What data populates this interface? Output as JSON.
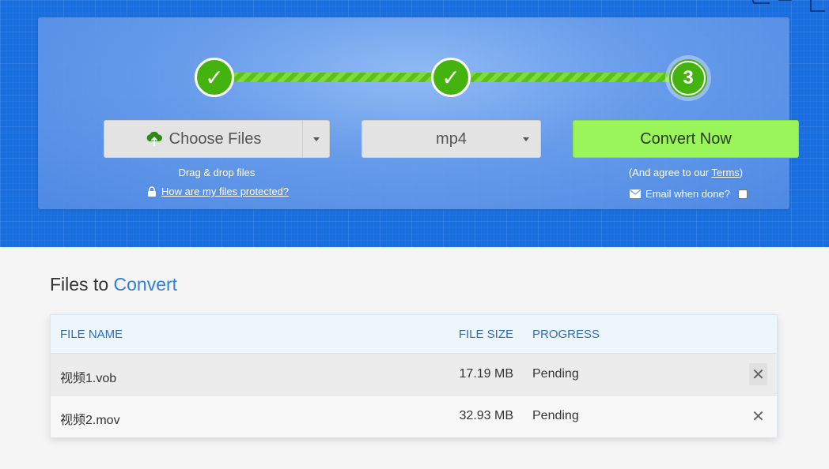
{
  "steps": [
    {
      "label": "✓",
      "state": "done"
    },
    {
      "label": "✓",
      "state": "done"
    },
    {
      "label": "3",
      "state": "current"
    }
  ],
  "choose_files": {
    "label": "Choose Files",
    "icon": "upload-cloud-icon"
  },
  "format_select": {
    "value": "mp4"
  },
  "convert_button": {
    "label": "Convert Now"
  },
  "drag_text": "Drag & drop files",
  "protect_link": "How are my files protected?",
  "agree_prefix": "(And agree to our ",
  "agree_link": "Terms",
  "agree_suffix": ")",
  "email_label": "Email when done?",
  "section": {
    "title_prefix": "Files to ",
    "title_accent": "Convert"
  },
  "table": {
    "headers": {
      "name": "FILE NAME",
      "size": "FILE SIZE",
      "progress": "PROGRESS"
    },
    "rows": [
      {
        "name": "视频1.vob",
        "size": "17.19 MB",
        "progress": "Pending"
      },
      {
        "name": "视频2.mov",
        "size": "32.93 MB",
        "progress": "Pending"
      }
    ],
    "remove_glyph": "✕"
  },
  "colors": {
    "hero": "#1a6fe0",
    "success": "#45b30f",
    "convert": "#9af55a",
    "accent": "#2f80d6"
  }
}
